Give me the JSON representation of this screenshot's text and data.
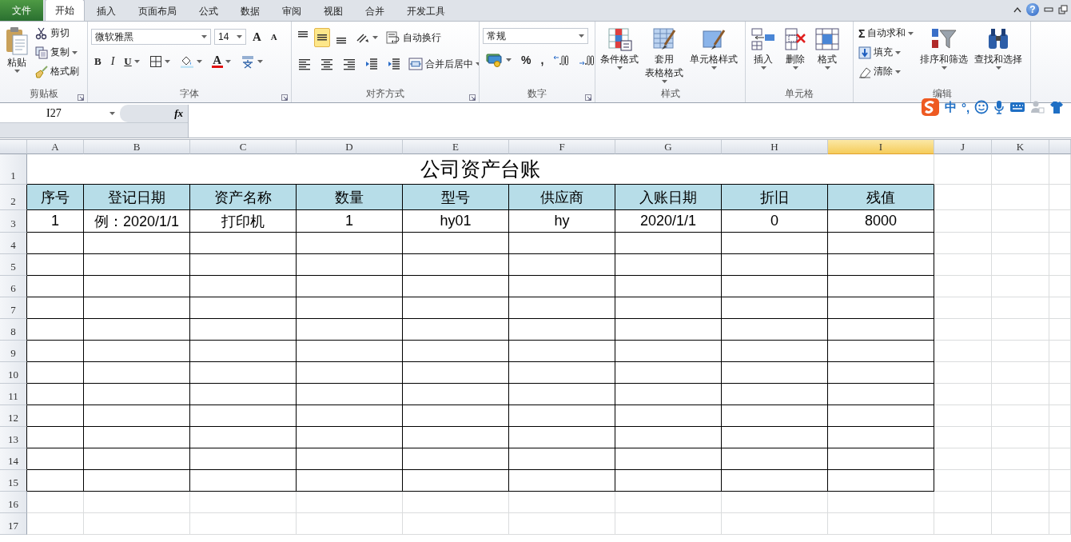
{
  "menu_tabs": [
    {
      "label": "文件",
      "kind": "file",
      "selected": false
    },
    {
      "label": "开始",
      "kind": "tab",
      "selected": true
    },
    {
      "label": "插入",
      "kind": "tab",
      "selected": false
    },
    {
      "label": "页面布局",
      "kind": "tab",
      "selected": false
    },
    {
      "label": "公式",
      "kind": "tab",
      "selected": false
    },
    {
      "label": "数据",
      "kind": "tab",
      "selected": false
    },
    {
      "label": "审阅",
      "kind": "tab",
      "selected": false
    },
    {
      "label": "视图",
      "kind": "tab",
      "selected": false
    },
    {
      "label": "合并",
      "kind": "tab",
      "selected": false
    },
    {
      "label": "开发工具",
      "kind": "tab",
      "selected": false
    }
  ],
  "window_controls": {
    "help": "?"
  },
  "ribbon": {
    "groups": [
      {
        "kind": "clipboard",
        "label": "剪贴板",
        "launcher": true,
        "items": [
          {
            "kind": "large",
            "label": "粘贴",
            "caret": true
          },
          {
            "kind": "small",
            "label": "剪切",
            "caret": false
          },
          {
            "kind": "small",
            "label": "复制",
            "caret": true
          },
          {
            "kind": "small",
            "label": "格式刷",
            "caret": false
          }
        ]
      },
      {
        "kind": "font",
        "label": "字体",
        "launcher": true,
        "items": [
          {
            "kind": "field",
            "value": "微软雅黑"
          },
          {
            "kind": "field",
            "value": "14"
          },
          {
            "kind": "glyph",
            "label": "A",
            "caret": false
          },
          {
            "kind": "glyph",
            "label": "A",
            "caret": false
          },
          {
            "kind": "glyph",
            "label": "B",
            "caret": false
          },
          {
            "kind": "glyph",
            "label": "I",
            "caret": false
          },
          {
            "kind": "glyph",
            "label": "U",
            "caret": true
          },
          {
            "kind": "icon",
            "caret": true
          },
          {
            "kind": "icon",
            "caret": true
          },
          {
            "kind": "glyph",
            "label": "A",
            "caret": true
          },
          {
            "kind": "icon",
            "caret": true
          }
        ]
      },
      {
        "kind": "alignment",
        "label": "对齐方式",
        "launcher": true,
        "items": [
          {
            "kind": "toggle",
            "selected": false
          },
          {
            "kind": "toggle",
            "selected": true
          },
          {
            "kind": "toggle",
            "selected": false
          },
          {
            "kind": "icon",
            "caret": true
          },
          {
            "kind": "small",
            "label": "自动换行",
            "caret": false
          },
          {
            "kind": "toggle",
            "selected": false
          },
          {
            "kind": "toggle",
            "selected": false
          },
          {
            "kind": "toggle",
            "selected": false
          },
          {
            "kind": "icon",
            "caret": false
          },
          {
            "kind": "icon",
            "caret": false
          },
          {
            "kind": "small",
            "label": "合并后居中",
            "caret": true
          }
        ]
      },
      {
        "kind": "number",
        "label": "数字",
        "launcher": true,
        "items": [
          {
            "kind": "field",
            "value": "常规"
          },
          {
            "kind": "icon",
            "caret": true
          },
          {
            "kind": "glyph",
            "label": "%",
            "caret": false
          },
          {
            "kind": "glyph",
            "label": ",",
            "caret": false
          },
          {
            "kind": "icon",
            "caret": false
          },
          {
            "kind": "icon",
            "caret": false
          }
        ]
      },
      {
        "kind": "styles",
        "label": "样式",
        "launcher": false,
        "items": [
          {
            "kind": "large",
            "label": "条件格式",
            "caret": true
          },
          {
            "kind": "large",
            "lines": [
              "套用",
              "表格格式"
            ],
            "caret": true
          },
          {
            "kind": "large",
            "label": "单元格样式",
            "caret": true
          }
        ]
      },
      {
        "kind": "cells",
        "label": "单元格",
        "launcher": false,
        "items": [
          {
            "kind": "large",
            "label": "插入",
            "caret": true
          },
          {
            "kind": "large",
            "label": "删除",
            "caret": true
          },
          {
            "kind": "large",
            "label": "格式",
            "caret": true
          }
        ]
      },
      {
        "kind": "editing",
        "label": "编辑",
        "launcher": false,
        "items": [
          {
            "kind": "small",
            "label": "自动求和",
            "symbol": "Σ",
            "caret": true
          },
          {
            "kind": "small",
            "label": "填充",
            "caret": true
          },
          {
            "kind": "small",
            "label": "清除",
            "caret": true
          },
          {
            "kind": "large",
            "label": "排序和筛选",
            "caret": true
          },
          {
            "kind": "large",
            "label": "查找和选择",
            "caret": true
          }
        ]
      }
    ]
  },
  "formula_bar": {
    "name_box": "I27",
    "fx": "fx"
  },
  "ime_toolbar": {
    "mode": "中",
    "punctuation": "°,"
  },
  "sheet": {
    "columns": [
      {
        "label": "A",
        "selected": false
      },
      {
        "label": "B",
        "selected": false
      },
      {
        "label": "C",
        "selected": false
      },
      {
        "label": "D",
        "selected": false
      },
      {
        "label": "E",
        "selected": false
      },
      {
        "label": "F",
        "selected": false
      },
      {
        "label": "G",
        "selected": false
      },
      {
        "label": "H",
        "selected": false
      },
      {
        "label": "I",
        "selected": true
      },
      {
        "label": "J",
        "selected": false
      },
      {
        "label": "K",
        "selected": false
      }
    ],
    "rows": [
      {
        "number": "1",
        "kind": "title",
        "text": "公司资产台账"
      },
      {
        "number": "2",
        "kind": "header",
        "cells": [
          "序号",
          "登记日期",
          "资产名称",
          "数量",
          "型号",
          "供应商",
          "入账日期",
          "折旧",
          "残值"
        ]
      },
      {
        "number": "3",
        "kind": "data",
        "cells": [
          "1",
          "例：2020/1/1",
          "打印机",
          "1",
          "hy01",
          "hy",
          "2020/1/1",
          "0",
          "8000"
        ]
      },
      {
        "number": "4",
        "kind": "blank"
      },
      {
        "number": "5",
        "kind": "blank"
      },
      {
        "number": "6",
        "kind": "blank"
      },
      {
        "number": "7",
        "kind": "blank"
      },
      {
        "number": "8",
        "kind": "blank"
      },
      {
        "number": "9",
        "kind": "blank"
      },
      {
        "number": "10",
        "kind": "blank"
      },
      {
        "number": "11",
        "kind": "blank"
      },
      {
        "number": "12",
        "kind": "blank"
      },
      {
        "number": "13",
        "kind": "blank"
      },
      {
        "number": "14",
        "kind": "blank"
      },
      {
        "number": "15",
        "kind": "blank"
      },
      {
        "number": "16",
        "kind": "plain"
      },
      {
        "number": "17",
        "kind": "plain"
      }
    ]
  }
}
